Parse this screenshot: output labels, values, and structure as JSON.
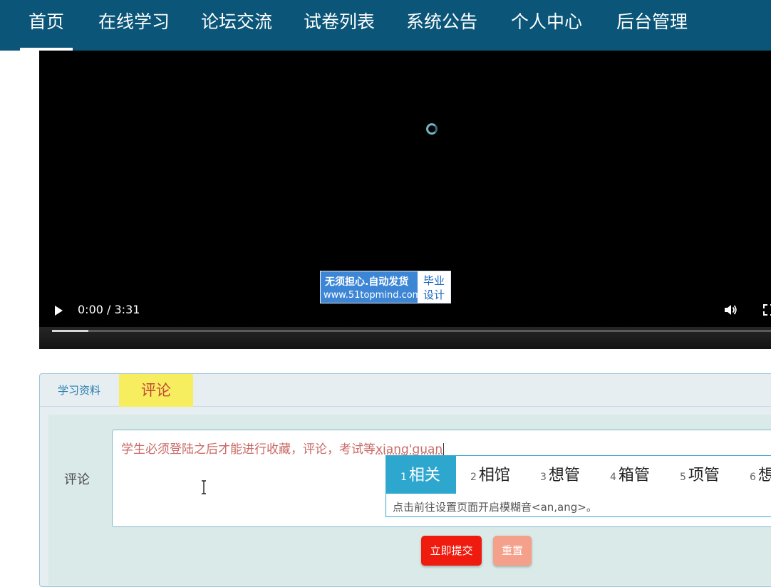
{
  "nav": {
    "items": [
      {
        "label": "首页",
        "active": true
      },
      {
        "label": "在线学习"
      },
      {
        "label": "论坛交流"
      },
      {
        "label": "试卷列表"
      },
      {
        "label": "系统公告"
      },
      {
        "label": "个人中心"
      },
      {
        "label": "后台管理"
      }
    ]
  },
  "video": {
    "watermark": {
      "line1": "无须担心.自动发货",
      "line2": "www.51topmind.com",
      "badge_line1": "毕业",
      "badge_line2": "设计"
    },
    "time": "0:00 / 3:31",
    "progress": 0.05,
    "icons": {
      "play": "play-icon",
      "volume": "volume-icon",
      "fullscreen": "fullscreen-icon",
      "loading": "spinner-icon"
    }
  },
  "tabs": [
    {
      "label": "学习资料"
    },
    {
      "label": "评论",
      "active": true
    }
  ],
  "comment_form": {
    "label": "评论",
    "text": "学生必须登陆之后才能进行收藏，评论，考试等",
    "composition": "xiang'guan",
    "submit_label": "立即提交",
    "reset_label": "重置"
  },
  "ime": {
    "candidates": [
      {
        "num": "1",
        "text": "相关"
      },
      {
        "num": "2",
        "text": "相馆"
      },
      {
        "num": "3",
        "text": "想管"
      },
      {
        "num": "4",
        "text": "箱管"
      },
      {
        "num": "5",
        "text": "项管"
      },
      {
        "num": "6",
        "text": "想"
      }
    ],
    "hint": "点击前往设置页面开启模糊音<an,ang>。"
  },
  "colors": {
    "nav_bg": "#0a5578",
    "tab_active_bg": "#f7ee5f",
    "submit_bg": "#ef1b0f",
    "reset_bg": "#f5a08a",
    "ime_active": "#2ea7cf"
  }
}
